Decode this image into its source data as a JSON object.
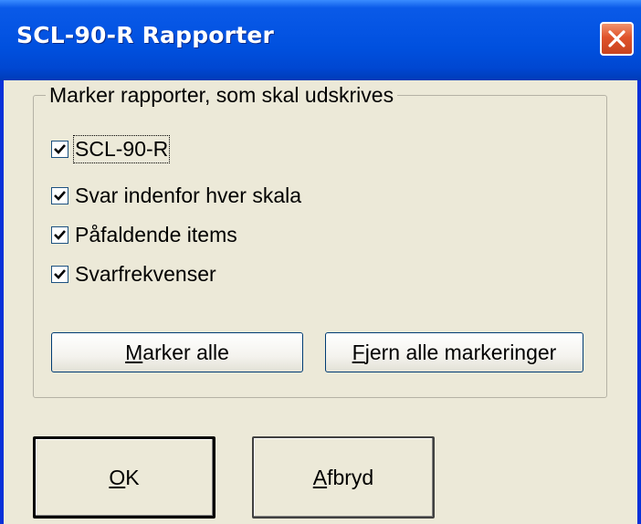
{
  "window": {
    "title": "SCL-90-R  Rapporter"
  },
  "group": {
    "legend": "Marker rapporter, som skal udskrives"
  },
  "checkboxes": [
    {
      "label": "SCL-90-R",
      "checked": true,
      "focused": true
    },
    {
      "label": "Svar indenfor hver skala",
      "checked": true,
      "focused": false
    },
    {
      "label": "Påfaldende items",
      "checked": true,
      "focused": false
    },
    {
      "label": "Svarfrekvenser",
      "checked": true,
      "focused": false
    }
  ],
  "buttons": {
    "select_all": {
      "access_key": "M",
      "rest": "arker alle"
    },
    "clear_all": {
      "access_key": "F",
      "rest": "jern alle markeringer"
    },
    "ok": {
      "access_key": "O",
      "rest": "K"
    },
    "cancel": {
      "access_key": "A",
      "rest": "fbryd"
    }
  },
  "colors": {
    "titlebar": "#0054e3",
    "client": "#ece9d8",
    "close_button": "#e0532b",
    "frame": "#0831d9"
  },
  "icons": {
    "close": "close-icon",
    "check": "checkmark-icon"
  }
}
